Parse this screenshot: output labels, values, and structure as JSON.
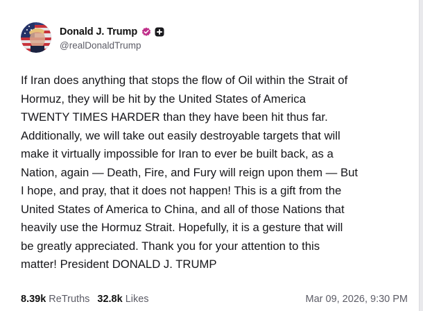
{
  "author": {
    "display_name": "Donald J. Trump",
    "handle": "@realDonaldTrump",
    "verified_color": "#c0308a",
    "badges": [
      "verified-badge-icon",
      "plus-badge-icon"
    ]
  },
  "post": {
    "lines": [
      "If Iran does anything that stops the flow of Oil within the Strait of",
      "Hormuz, they will be hit by the United States of America",
      "TWENTY TIMES HARDER than they have been hit thus far.",
      "Additionally, we will take out easily destroyable targets that will",
      "make it virtually impossible for Iran to ever be built back, as a",
      "Nation, again — Death, Fire, and Fury will reign upon them — But",
      "I hope, and pray, that it does not happen! This is a gift from the",
      "United States of America to China, and all of those Nations that",
      "heavily use the Hormuz Strait. Hopefully, it is a gesture that will",
      "be greatly appreciated. Thank you for your attention to this",
      "matter! President DONALD J. TRUMP"
    ]
  },
  "stats": {
    "retruths_count": "8.39k",
    "retruths_label": "ReTruths",
    "likes_count": "32.8k",
    "likes_label": "Likes"
  },
  "timestamp": "Mar 09, 2026, 9:30 PM"
}
